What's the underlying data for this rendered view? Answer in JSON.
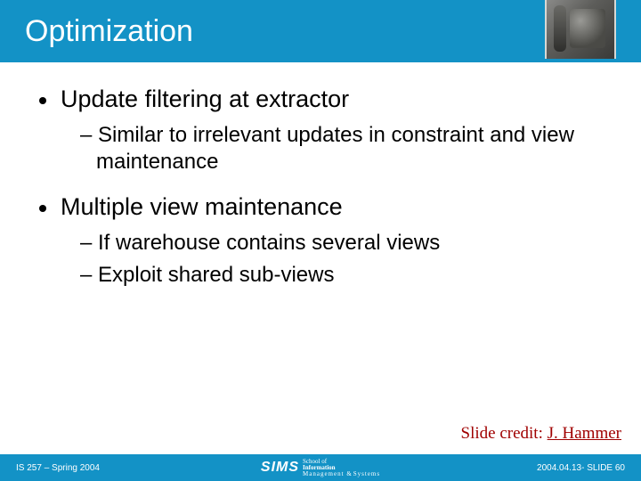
{
  "title": "Optimization",
  "bullets": {
    "b1a": "Update filtering at extractor",
    "b1a_sub1": "– Similar to irrelevant updates in constraint and view maintenance",
    "b1b": "Multiple view maintenance",
    "b1b_sub1": "– If warehouse contains several views",
    "b1b_sub2": "– Exploit shared sub-views"
  },
  "credit_prefix": "Slide credit: ",
  "credit_name": "J. Hammer",
  "footer": {
    "left": "IS 257 – Spring 2004",
    "right": "2004.04.13- SLIDE 60",
    "logo": "SIMS",
    "sub1": "School of",
    "sub2": "Information",
    "sub3_prefix": "Management ",
    "sub3_amp": "&",
    "sub3_suffix": "Systems"
  }
}
